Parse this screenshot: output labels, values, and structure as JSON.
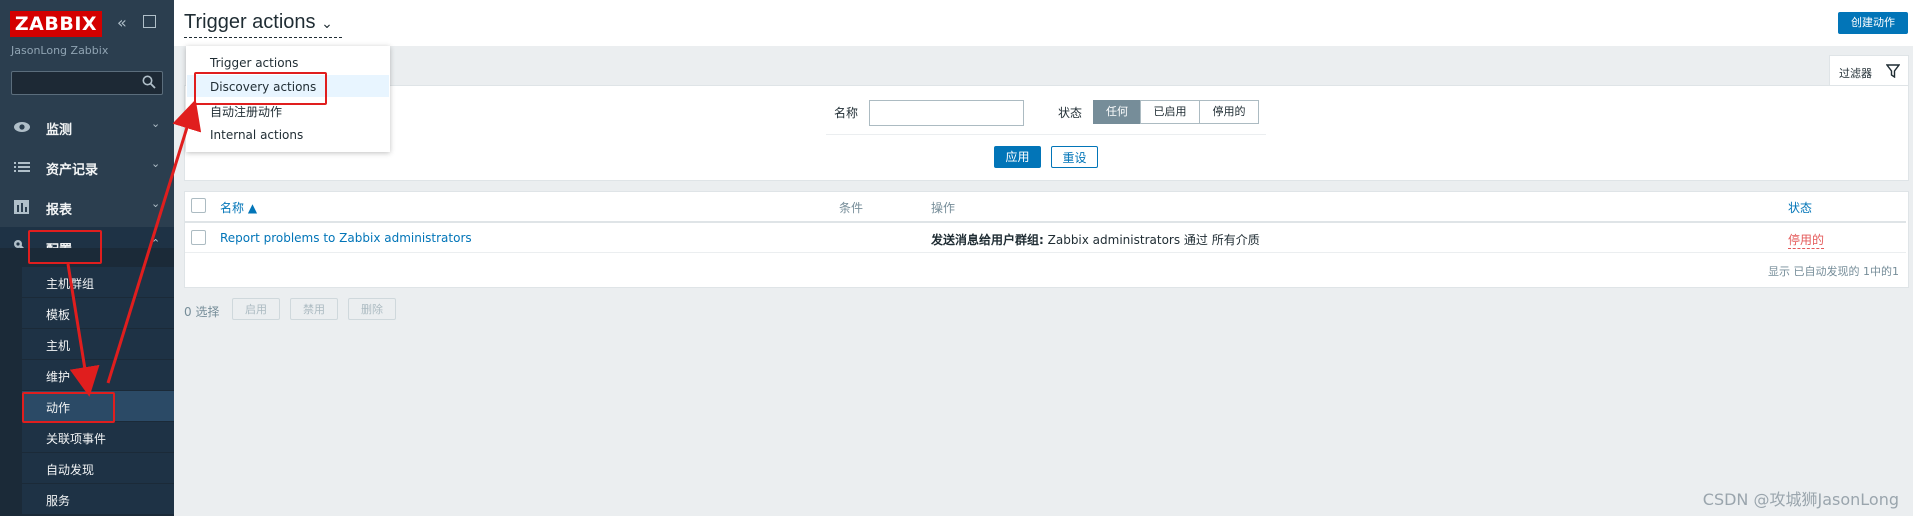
{
  "app": {
    "logo": "ZABBIX",
    "server_name": "JasonLong Zabbix",
    "collapse_icon": "double-chevron-left-icon",
    "kiosk_icon": "fullscreen-icon"
  },
  "sidebar": {
    "menu": [
      {
        "label": "监测",
        "icon": "eye-icon"
      },
      {
        "label": "资产记录",
        "icon": "list-icon"
      },
      {
        "label": "报表",
        "icon": "bar-chart-icon"
      },
      {
        "label": "配置",
        "icon": "wrench-icon"
      }
    ],
    "submenu": [
      "主机群组",
      "模板",
      "主机",
      "维护",
      "动作",
      "关联项事件",
      "自动发现",
      "服务"
    ]
  },
  "header": {
    "title": "Trigger actions",
    "create_button": "创建动作"
  },
  "dropdown": {
    "items": [
      "Trigger actions",
      "Discovery actions",
      "自动注册动作",
      "Internal actions"
    ]
  },
  "filter": {
    "tab_label": "过滤器",
    "name_label": "名称",
    "name_value": "",
    "status_label": "状态",
    "status_options": [
      "任何",
      "已启用",
      "停用的"
    ],
    "status_selected": "任何",
    "apply": "应用",
    "reset": "重设"
  },
  "table": {
    "headers": {
      "name": "名称 ▲",
      "conditions": "条件",
      "operations": "操作",
      "status": "状态"
    },
    "rows": [
      {
        "name": "Report problems to Zabbix administrators",
        "conditions": "",
        "operation_bold": "发送消息给用户群组:",
        "operation_rest": " Zabbix administrators 通过 所有介质",
        "status": "停用的"
      }
    ],
    "footer": "显示 已自动发现的 1中的1"
  },
  "bulk": {
    "selected": "0 选择",
    "enable": "启用",
    "disable": "禁用",
    "delete": "删除"
  },
  "colors": {
    "sidebar": "#2b3e4f",
    "accent": "#0275b8",
    "logo": "#d40000",
    "annotation": "#e01e1e",
    "disabled_status": "#e45959"
  },
  "watermark": "CSDN @攻城狮JasonLong"
}
